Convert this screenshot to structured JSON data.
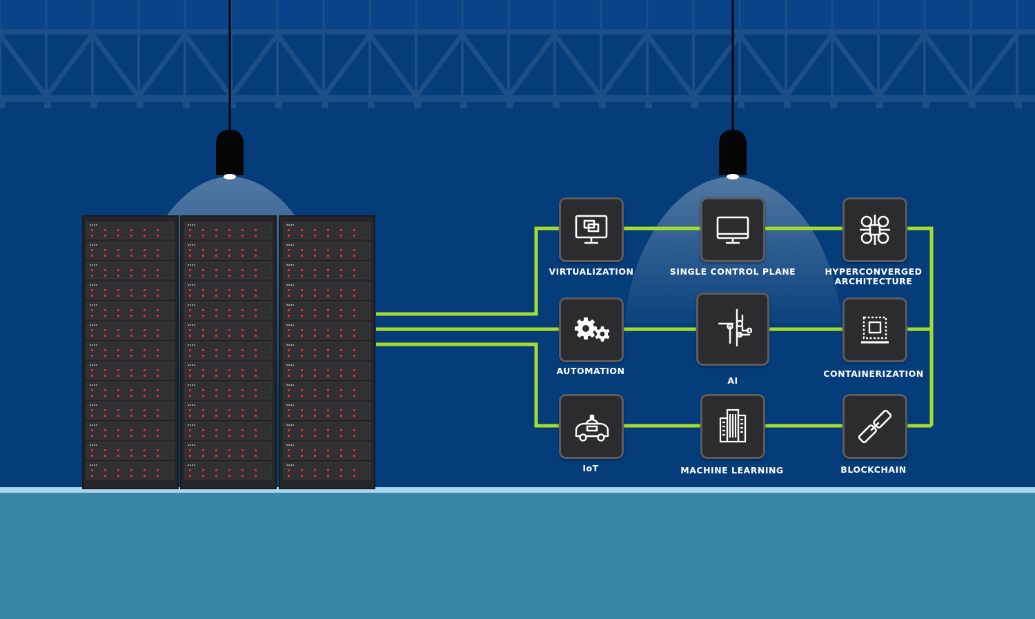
{
  "nodes": [
    {
      "id": "virtualization",
      "label": "VIRTUALIZATION",
      "icon": "virtualization-icon"
    },
    {
      "id": "single-control-plane",
      "label": "SINGLE CONTROL PLANE",
      "icon": "monitor-icon"
    },
    {
      "id": "hyperconverged-architecture",
      "label_line1": "HYPERCONVERGED",
      "label_line2": "ARCHITECTURE",
      "icon": "node-cluster-icon"
    },
    {
      "id": "automation",
      "label": "AUTOMATION",
      "icon": "gears-icon"
    },
    {
      "id": "ai",
      "label": "AI",
      "icon": "circuit-icon"
    },
    {
      "id": "containerization",
      "label": "CONTAINERIZATION",
      "icon": "container-icon"
    },
    {
      "id": "iot",
      "label": "IoT",
      "icon": "autonomous-car-icon"
    },
    {
      "id": "machine-learning",
      "label": "MACHINE LEARNING",
      "icon": "buildings-icon"
    },
    {
      "id": "blockchain",
      "label": "BLOCKCHAIN",
      "icon": "chain-link-icon"
    }
  ],
  "colors": {
    "background": "#053d7a",
    "truss": "#1c4f88",
    "floor": "#3885a8",
    "floor_edge": "#a8d6ee",
    "connector": "#a6dc2e",
    "tile": "#2c2c2e",
    "tile_border": "#5b5c60",
    "rack": "#262628",
    "server_led": "#e0303a"
  }
}
